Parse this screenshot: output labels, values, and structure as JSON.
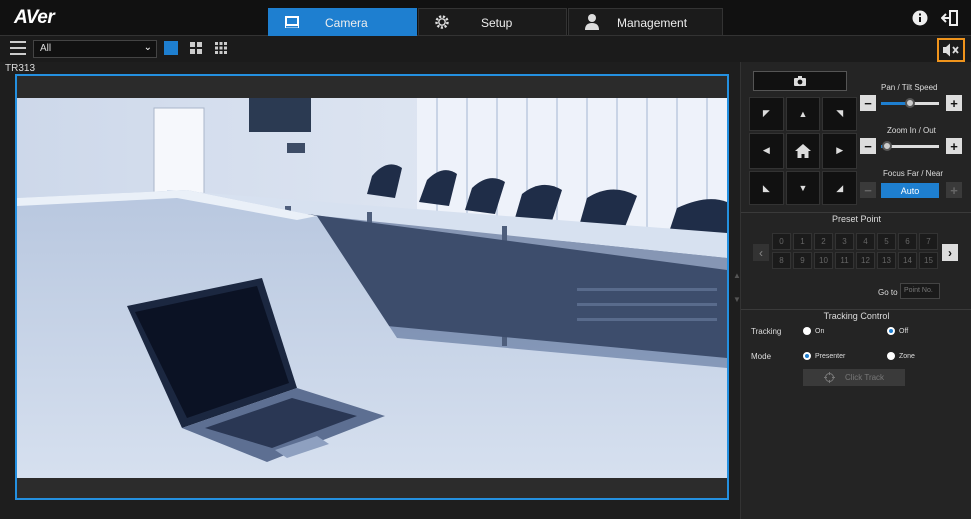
{
  "app": {
    "logo": "AVer"
  },
  "tabs": [
    {
      "label": "Camera",
      "icon": "camera-icon",
      "active": true
    },
    {
      "label": "Setup",
      "icon": "gear-icon",
      "active": false
    },
    {
      "label": "Management",
      "icon": "user-icon",
      "active": false
    }
  ],
  "toolbar": {
    "filter_value": "All"
  },
  "camera": {
    "name": "TR313"
  },
  "ptz": {
    "pan_tilt_label": "Pan / Tilt Speed",
    "pan_tilt_speed": 0.5,
    "zoom_label": "Zoom In / Out",
    "zoom_speed": 0.1,
    "focus_label": "Focus Far / Near",
    "focus_mode": "Auto"
  },
  "preset": {
    "title": "Preset Point",
    "points": [
      "0",
      "1",
      "2",
      "3",
      "4",
      "5",
      "6",
      "7",
      "8",
      "9",
      "10",
      "11",
      "12",
      "13",
      "14",
      "15"
    ],
    "goto_label": "Go to",
    "goto_placeholder": "Point No."
  },
  "tracking": {
    "title": "Tracking Control",
    "tracking_label": "Tracking",
    "on_label": "On",
    "off_label": "Off",
    "mode_label": "Mode",
    "presenter_label": "Presenter",
    "zone_label": "Zone",
    "click_track_label": "Click Track"
  },
  "colors": {
    "accent": "#1e7fd0",
    "highlight": "#f0941c",
    "background": "#1e1e1e"
  }
}
